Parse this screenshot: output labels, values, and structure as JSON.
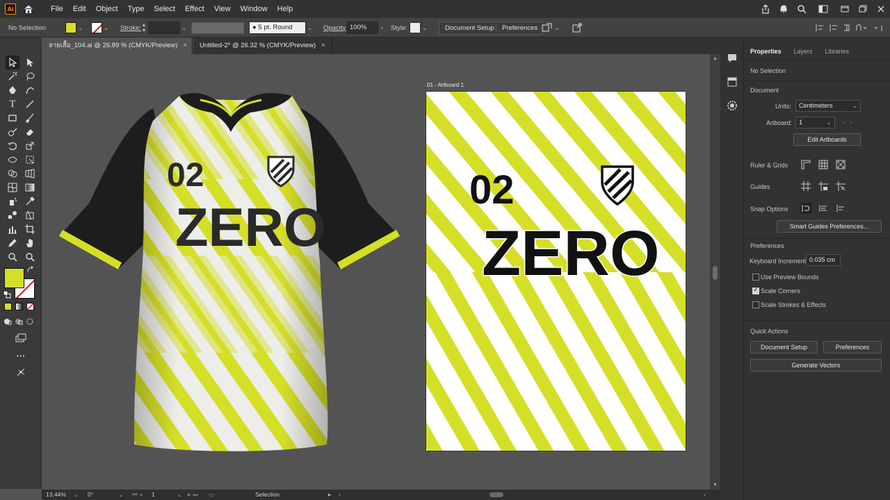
{
  "app": {
    "logo_text": "Ai"
  },
  "menu": [
    "File",
    "Edit",
    "Object",
    "Type",
    "Select",
    "Effect",
    "View",
    "Window",
    "Help"
  ],
  "control": {
    "selection": "No Selection",
    "stroke_label": "Stroke:",
    "brush": "5 pt. Round",
    "opacity_label": "Opacity:",
    "opacity": "100%",
    "style_label": "Style:",
    "document_setup": "Document Setup",
    "preferences": "Preferences",
    "fill_color": "#d5df27"
  },
  "tabs": [
    {
      "label": "ลายเสื้อ_104.ai @ 26.89 % (CMYK/Preview)",
      "close": "×"
    },
    {
      "label": "Untitled-2* @ 26.32 % (CMYK/Preview)",
      "close": "×"
    }
  ],
  "artboard": {
    "label": "01 - Artboard 1"
  },
  "design": {
    "number": "02",
    "name": "ZERO",
    "accent": "#d5df27"
  },
  "status": {
    "zoom": "13.44%",
    "rotation": "0°",
    "artboard": "1",
    "tool": "Selection"
  },
  "panel": {
    "tabs": [
      "Properties",
      "Layers",
      "Libraries"
    ],
    "selection": "No Selection",
    "document_heading": "Document",
    "units_label": "Units:",
    "units": "Centimeters",
    "artboard_label": "Artboard:",
    "artboard": "1",
    "edit_artboards": "Edit Artboards",
    "ruler_grids": "Ruler & Grids",
    "guides": "Guides",
    "snap_options": "Snap Options",
    "smart_guides": "Smart Guides Preferences...",
    "preferences_heading": "Preferences",
    "keyboard_increment_label": "Keyboard Increment:",
    "keyboard_increment": "0.035 cm",
    "use_preview_bounds": "Use Preview Bounds",
    "scale_corners": "Scale Corners",
    "scale_strokes": "Scale Strokes & Effects",
    "quick_actions": "Quick Actions",
    "qa_document_setup": "Document Setup",
    "qa_preferences": "Preferences",
    "generate_vectors": "Generate Vectors"
  }
}
